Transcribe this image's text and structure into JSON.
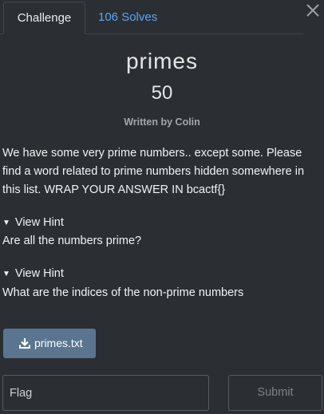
{
  "tabs": {
    "challenge": "Challenge",
    "solves": "106 Solves"
  },
  "challenge": {
    "name": "primes",
    "points": "50",
    "author": "Written by Colin",
    "description": "We have some very prime numbers.. except some. Please find a word related to prime numbers hidden somewhere in this list. WRAP YOUR ANSWER IN bcactf{}"
  },
  "hints": [
    {
      "toggle_label": "View Hint",
      "text": "Are all the numbers prime?"
    },
    {
      "toggle_label": "View Hint",
      "text": "What are the indices of the non-prime numbers"
    }
  ],
  "file": {
    "label": "primes.txt",
    "icon": "download-icon"
  },
  "flag_input": {
    "placeholder": "Flag",
    "value": ""
  },
  "submit": {
    "label": "Submit"
  },
  "colors": {
    "background": "#2b2f33",
    "accent_link": "#5aa5f0",
    "file_button": "#5a7590",
    "muted_text": "#a3a8ad"
  }
}
